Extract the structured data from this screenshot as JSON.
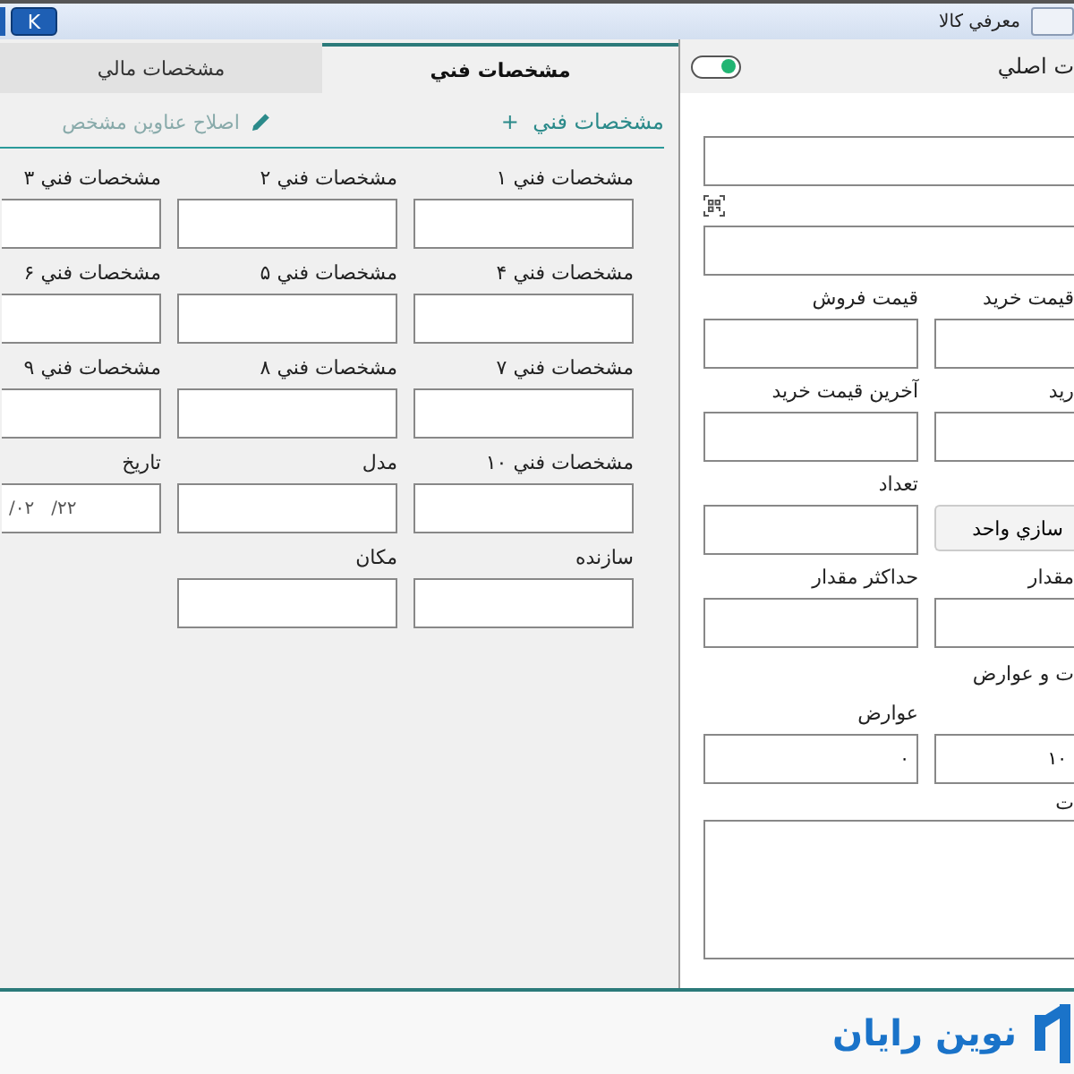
{
  "window": {
    "title": "معرفي كالا",
    "k_button": "K"
  },
  "left_panel": {
    "tabs": [
      {
        "label": "مشخصات فني",
        "selected": true
      },
      {
        "label": "مشخصات مالي",
        "selected": false
      }
    ],
    "toolbar": {
      "add_label": "مشخصات فني",
      "add_symbol": "+",
      "edit_label": "اصلاح عناوين مشخص"
    },
    "fields": [
      {
        "label": "مشخصات فني ۱"
      },
      {
        "label": "مشخصات فني ۲"
      },
      {
        "label": "مشخصات فني ۳"
      },
      {
        "label": "مشخصات فني ۴"
      },
      {
        "label": "مشخصات فني ۵"
      },
      {
        "label": "مشخصات فني ۶"
      },
      {
        "label": "مشخصات فني ۷"
      },
      {
        "label": "مشخصات فني ۸"
      },
      {
        "label": "مشخصات فني ۹"
      },
      {
        "label": "مشخصات فني ۱۰"
      },
      {
        "label": "مدل"
      },
      {
        "label": "تاريخ",
        "value": "/۰۲   /۲۲"
      },
      {
        "label": "سازنده"
      },
      {
        "label": "مكان"
      }
    ]
  },
  "right_panel": {
    "header": {
      "title": "ت اصلي",
      "toggle_on": true
    },
    "rows": [
      {
        "left": {
          "kind": "field",
          "label": "قيمت فروش"
        },
        "right": {
          "kind": "field",
          "label": "قيمت خريد"
        }
      },
      {
        "left": {
          "kind": "field",
          "label": "آخرين قيمت خريد"
        },
        "right": {
          "kind": "field",
          "label": "ريد"
        }
      },
      {
        "left": {
          "kind": "field",
          "label": "تعداد"
        },
        "right": {
          "kind": "button",
          "label": "سازي واحد"
        }
      },
      {
        "left": {
          "kind": "field",
          "label": "حداكثر مقدار"
        },
        "right": {
          "kind": "field",
          "label": "مقدار"
        }
      }
    ],
    "section_label": "ت و عوارض",
    "tax_row": {
      "left": {
        "label": "عوارض",
        "value": "۰"
      },
      "right": {
        "value": "۱۰"
      }
    },
    "notes_label": "ت"
  },
  "footer": {
    "brand": "نوين رايان"
  }
}
